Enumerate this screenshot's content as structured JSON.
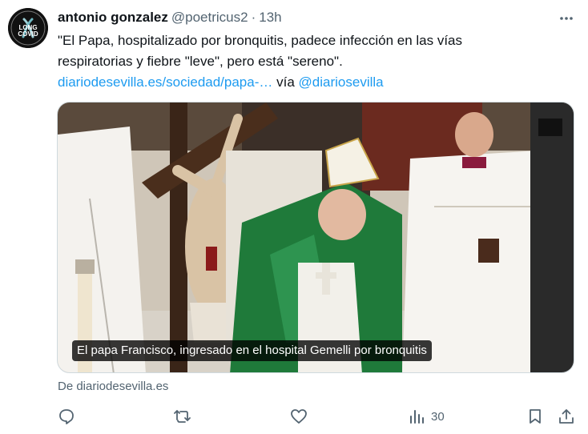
{
  "author": {
    "name": "antonio gonzalez",
    "handle": "@poetricus2",
    "separator": "·",
    "time": "13h",
    "avatar_lines": [
      "LONG",
      "COVID"
    ]
  },
  "tweet": {
    "text_line1": "\"El Papa, hospitalizado por bronquitis, padece infección en las vías",
    "text_line2": "respiratorias y fiebre \"leve\", pero está \"sereno\".",
    "link": "diariodesevilla.es/sociedad/papa-…",
    "via": "vía",
    "mention": "@diariosevilla"
  },
  "media": {
    "caption": "El papa Francisco, ingresado en el hospital Gemelli por bronquitis"
  },
  "source": "De diariodesevilla.es",
  "actions": {
    "views": "30"
  },
  "icons": {
    "more": "more-icon",
    "reply": "reply-icon",
    "retweet": "retweet-icon",
    "like": "like-icon",
    "views": "views-icon",
    "bookmark": "bookmark-icon",
    "share": "share-icon"
  },
  "colors": {
    "link": "#1d9bf0",
    "secondary": "#536471",
    "text": "#0f1419"
  }
}
